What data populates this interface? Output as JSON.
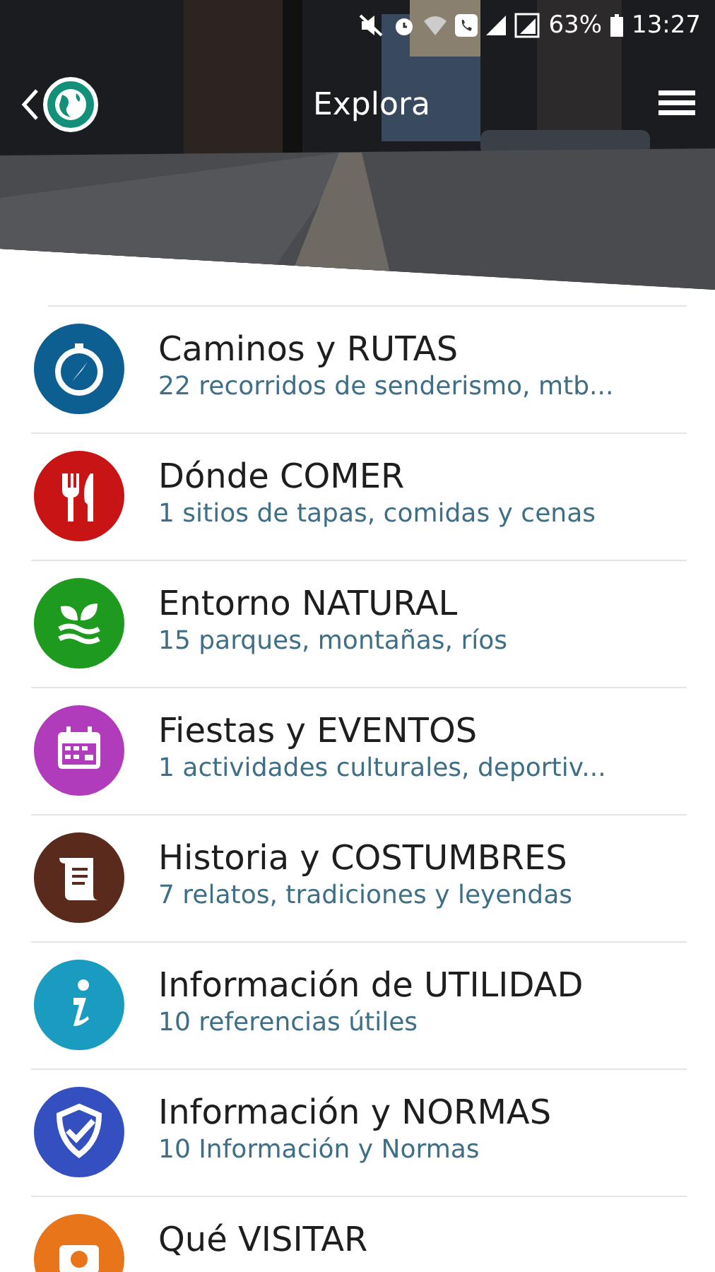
{
  "status_bar": {
    "battery": "63%",
    "time": "13:27"
  },
  "header": {
    "title": "Explora"
  },
  "items": [
    {
      "title": "Caminos y RUTAS",
      "subtitle": "22 recorridos de senderismo, mtb...",
      "kind": "compass",
      "color": "#0d5f92"
    },
    {
      "title": "Dónde COMER",
      "subtitle": "1 sitios de tapas, comidas y cenas",
      "kind": "cutlery",
      "color": "#c81414"
    },
    {
      "title": "Entorno NATURAL",
      "subtitle": "15 parques, montañas, ríos",
      "kind": "plant",
      "color": "#1e9a1e"
    },
    {
      "title": "Fiestas y EVENTOS",
      "subtitle": "1 actividades culturales, deportiv...",
      "kind": "calendar",
      "color": "#b03cbc"
    },
    {
      "title": "Historia y COSTUMBRES",
      "subtitle": "7 relatos, tradiciones y leyendas",
      "kind": "scroll",
      "color": "#5a2a1c"
    },
    {
      "title": "Información de UTILIDAD",
      "subtitle": "10 referencias útiles",
      "kind": "info",
      "color": "#1a9cc0"
    },
    {
      "title": "Información y NORMAS",
      "subtitle": "10 Información y Normas",
      "kind": "shield",
      "color": "#3450c0"
    },
    {
      "title": "Qué VISITAR",
      "kind": "camera",
      "color": "#e8751a"
    }
  ]
}
